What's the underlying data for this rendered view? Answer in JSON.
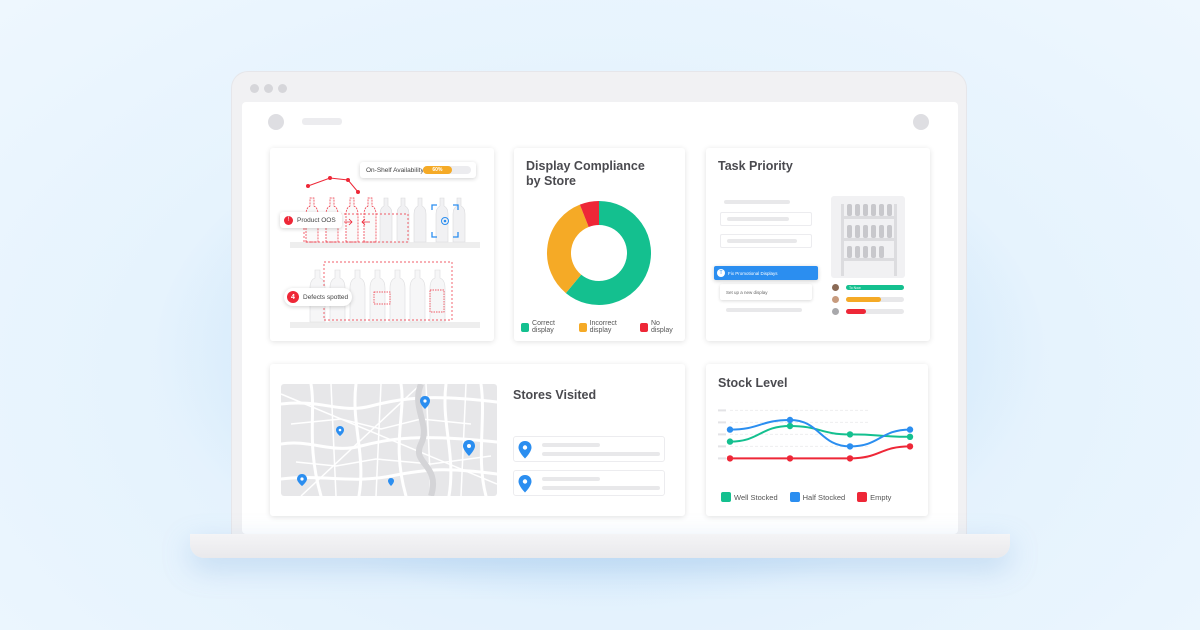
{
  "shelf_card": {
    "availability_label": "On-Shelf Availability",
    "availability_value": "60%",
    "availability_fraction": 0.6,
    "oos_label": "Product OOS",
    "defects_count": "4",
    "defects_label": "Defects spotted"
  },
  "compliance": {
    "title_line1": "Display Compliance",
    "title_line2": "by Store",
    "slices": [
      {
        "name": "Correct display",
        "value": 61,
        "color": "#14c08f"
      },
      {
        "name": "Incorrect display",
        "value": 33,
        "color": "#f5aa26"
      },
      {
        "name": "No display",
        "value": 6,
        "color": "#ee2737"
      }
    ]
  },
  "task_priority": {
    "title": "Task Priority",
    "highlight_label": "Fix Promotional Displays",
    "sub_label": "Set up a new display",
    "badge_label": "To Now",
    "priority_bars": [
      {
        "color": "#14c08f",
        "fill": 1.0
      },
      {
        "color": "#f5aa26",
        "fill": 0.6
      },
      {
        "color": "#ee2737",
        "fill": 0.35
      }
    ]
  },
  "stores": {
    "title": "Stores Visited"
  },
  "stock": {
    "title": "Stock Level",
    "legend": [
      {
        "name": "Well Stocked",
        "color": "#14c08f"
      },
      {
        "name": "Half Stocked",
        "color": "#2b8ef0"
      },
      {
        "name": "Empty",
        "color": "#ee2737"
      }
    ]
  },
  "chart_data": {
    "type": "line",
    "x": [
      1,
      2,
      3,
      4
    ],
    "ylim": [
      0,
      5
    ],
    "series": [
      {
        "name": "Well Stocked",
        "color": "#14c08f",
        "values": [
          2.2,
          3.5,
          2.8,
          2.6
        ]
      },
      {
        "name": "Half Stocked",
        "color": "#2b8ef0",
        "values": [
          3.2,
          4.0,
          1.8,
          3.2
        ]
      },
      {
        "name": "Empty",
        "color": "#ee2737",
        "values": [
          0.8,
          0.8,
          0.8,
          1.8
        ]
      }
    ]
  }
}
